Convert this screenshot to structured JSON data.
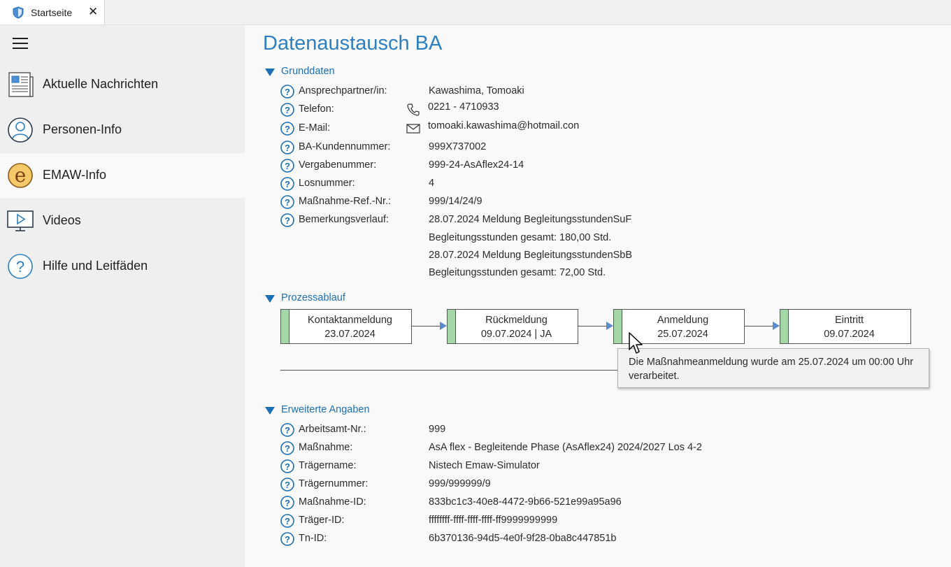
{
  "tab": {
    "title": "Startseite",
    "close_glyph": "✕",
    "icon": "shield-icon"
  },
  "sidebar": {
    "menu_icon": "hamburger-icon",
    "items": [
      {
        "label": "Aktuelle Nachrichten",
        "icon": "newspaper-icon",
        "active": false
      },
      {
        "label": "Personen-Info",
        "icon": "person-icon",
        "active": false
      },
      {
        "label": "EMAW-Info",
        "icon": "emaw-e-icon",
        "active": true
      },
      {
        "label": "Videos",
        "icon": "video-monitor-icon",
        "active": false
      },
      {
        "label": "Hilfe und Leitfäden",
        "icon": "help-circle-icon",
        "active": false
      }
    ]
  },
  "main": {
    "title": "Datenaustausch BA",
    "grunddaten": {
      "heading": "Grunddaten",
      "rows": [
        {
          "label": "Ansprechpartner/in:",
          "value": "Kawashima, Tomoaki"
        },
        {
          "label": "Telefon:",
          "value": "0221 - 4710933",
          "icon": "phone-icon"
        },
        {
          "label": "E-Mail:",
          "value": "tomoaki.kawashima@hotmail.con",
          "icon": "mail-icon"
        },
        {
          "label": "BA-Kundennummer:",
          "value": "999X737002"
        },
        {
          "label": "Vergabenummer:",
          "value": "999-24-AsAflex24-14"
        },
        {
          "label": "Losnummer:",
          "value": "4"
        },
        {
          "label": "Maßnahme-Ref.-Nr.:",
          "value": "999/14/24/9"
        },
        {
          "label": "Bemerkungsverlauf:",
          "value": "28.07.2024 Meldung BegleitungsstundenSuF"
        }
      ],
      "remarks": [
        "Begleitungsstunden gesamt: 180,00 Std.",
        "28.07.2024 Meldung BegleitungsstundenSbB",
        "Begleitungsstunden gesamt: 72,00 Std."
      ]
    },
    "prozess": {
      "heading": "Prozessablauf",
      "steps": [
        {
          "title": "Kontaktanmeldung",
          "detail": "23.07.2024"
        },
        {
          "title": "Rückmeldung",
          "detail": "09.07.2024 | JA"
        },
        {
          "title": "Anmeldung",
          "detail": "25.07.2024"
        },
        {
          "title": "Eintritt",
          "detail": "09.07.2024"
        }
      ],
      "tooltip": {
        "line1": "Die Maßnahmeanmeldung wurde am 25.07.2024 um 00:00 Uhr",
        "line2": "verarbeitet."
      }
    },
    "erweitert": {
      "heading": "Erweiterte Angaben",
      "rows": [
        {
          "label": "Arbeitsamt-Nr.:",
          "value": "999"
        },
        {
          "label": "Maßnahme:",
          "value": "AsA flex - Begleitende Phase (AsAflex24) 2024/2027 Los 4-2"
        },
        {
          "label": "Trägername:",
          "value": "Nistech Emaw-Simulator"
        },
        {
          "label": "Trägernummer:",
          "value": "999/999999/9"
        },
        {
          "label": "Maßnahme-ID:",
          "value": "833bc1c3-40e8-4472-9b66-521e99a95a96"
        },
        {
          "label": "Träger-ID:",
          "value": "ffffffff-ffff-ffff-ffff-ff9999999999"
        },
        {
          "label": "Tn-ID:",
          "value": "6b370136-94d5-4e0f-9f28-0ba8c447851b"
        }
      ]
    }
  },
  "colors": {
    "accent": "#2e7fc0",
    "step_bar": "#a5d6a7",
    "help_icon": "#1d6fb5"
  }
}
